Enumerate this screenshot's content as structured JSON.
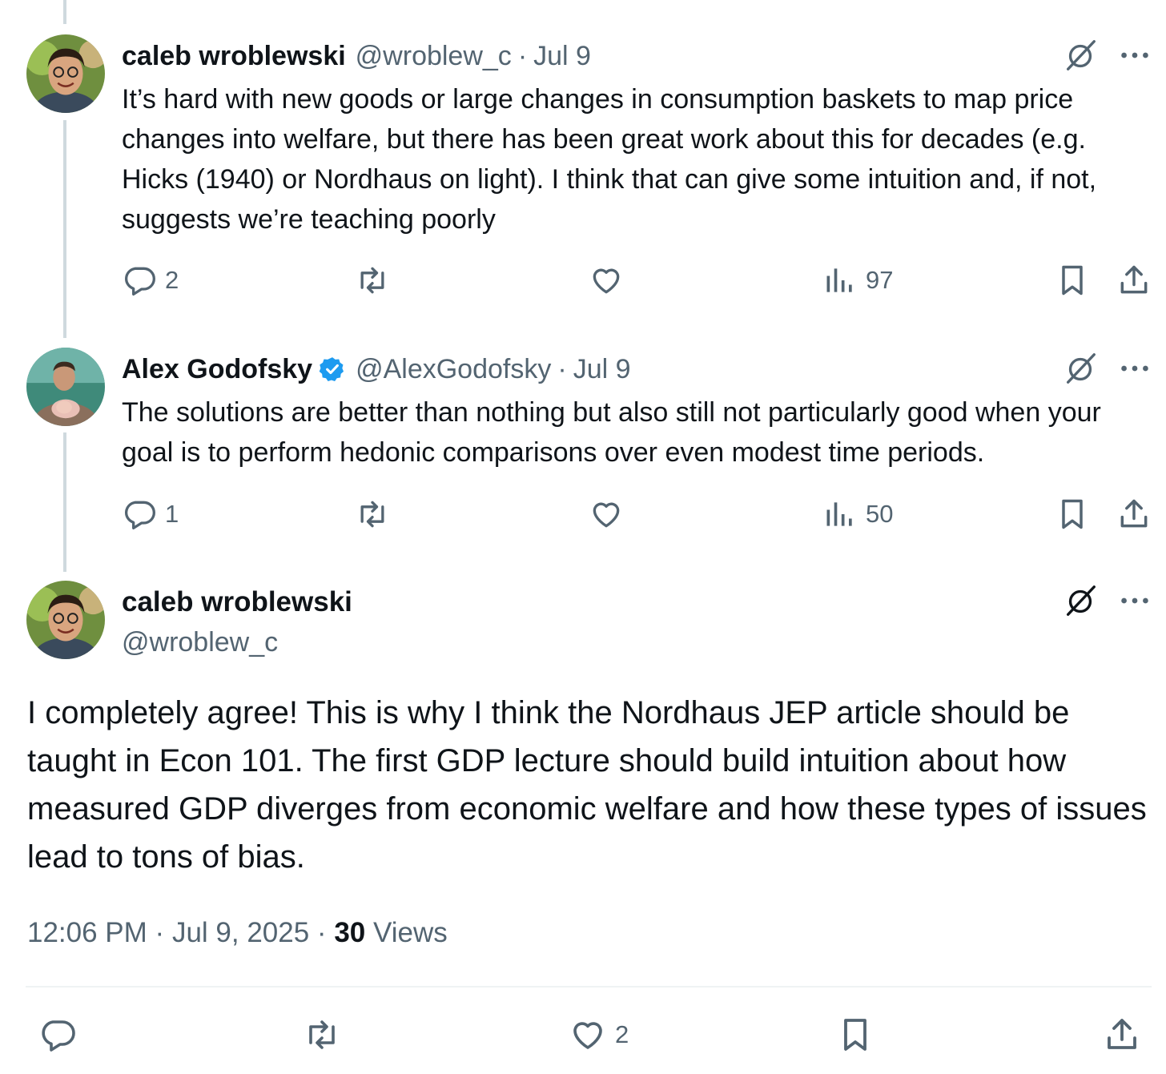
{
  "tweets": [
    {
      "name": "caleb wroblewski",
      "handle": "@wroblew_c",
      "date": "Jul 9",
      "text": "It’s hard with new goods or large changes in consumption baskets to map price changes into welfare, but there has been great work about this for decades (e.g. Hicks (1940) or Nordhaus on light). I think that can give some intuition and, if not, suggests we’re teaching poorly",
      "replies": "2",
      "retweets": "",
      "likes": "",
      "views": "97"
    },
    {
      "name": "Alex Godofsky",
      "handle": "@AlexGodofsky",
      "date": "Jul 9",
      "text": "The solutions are better than nothing but also still not particularly good when your goal is to perform hedonic comparisons over even modest time periods.",
      "replies": "1",
      "retweets": "",
      "likes": "",
      "views": "50"
    }
  ],
  "main": {
    "name": "caleb wroblewski",
    "handle": "@wroblew_c",
    "text": "I completely agree! This is why I think the Nordhaus JEP article should be taught in Econ 101. The first GDP lecture should build intuition about how measured GDP diverges from economic welfare and how these types of issues lead to tons of bias.",
    "time": "12:06 PM",
    "date": "Jul 9, 2025",
    "views_count": "30",
    "views_label": "Views",
    "likes": "2"
  },
  "separator": "·",
  "colors": {
    "text": "#0f1419",
    "secondary": "#536471",
    "verified": "#1d9bf0",
    "thread_line": "#cfd9de"
  },
  "icons": [
    "grok-icon",
    "more-icon",
    "reply-icon",
    "retweet-icon",
    "like-icon",
    "views-icon",
    "bookmark-icon",
    "share-icon",
    "verified-badge-icon"
  ]
}
